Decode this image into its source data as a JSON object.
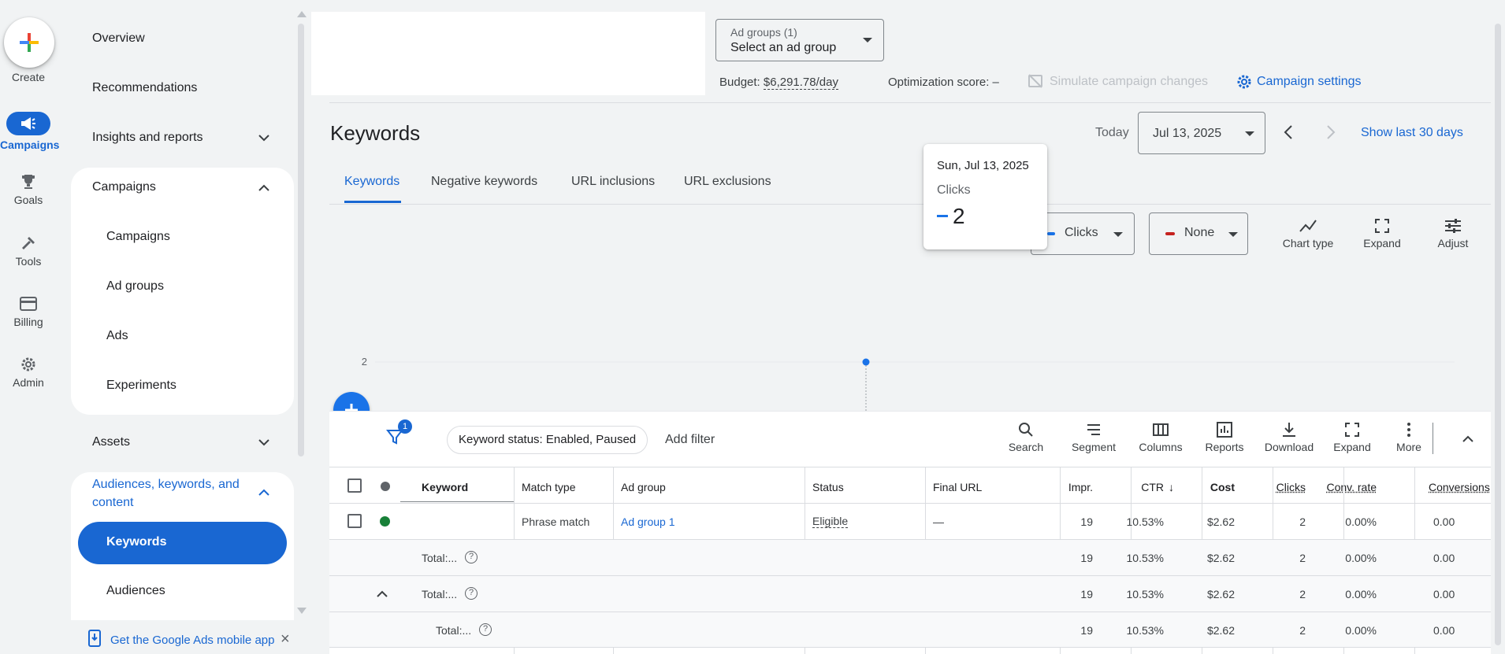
{
  "rail": {
    "create": "Create",
    "campaigns": "Campaigns",
    "goals": "Goals",
    "tools": "Tools",
    "billing": "Billing",
    "admin": "Admin"
  },
  "menu": {
    "overview": "Overview",
    "recommendations": "Recommendations",
    "insights": "Insights and reports",
    "campaigns_group": "Campaigns",
    "campaigns": "Campaigns",
    "ad_groups": "Ad groups",
    "ads": "Ads",
    "experiments": "Experiments",
    "assets": "Assets",
    "audiences_group": "Audiences, keywords, and content",
    "keywords": "Keywords",
    "audiences": "Audiences",
    "mobile_app": "Get the Google Ads mobile app"
  },
  "header": {
    "adgroup_label": "Ad groups (1)",
    "adgroup_value": "Select an ad group",
    "budget_label": "Budget:",
    "budget_value": "$6,291.78/day",
    "opt_score": "Optimization score: –",
    "simulate": "Simulate campaign changes",
    "settings": "Campaign settings"
  },
  "page": {
    "title": "Keywords",
    "today": "Today",
    "date": "Jul 13, 2025",
    "show_last": "Show last 30 days"
  },
  "tabs": [
    "Keywords",
    "Negative keywords",
    "URL inclusions",
    "URL exclusions"
  ],
  "chart_controls": {
    "metric1": "Clicks",
    "metric2": "None",
    "chart_type": "Chart type",
    "expand": "Expand",
    "adjust": "Adjust"
  },
  "tooltip": {
    "date": "Sun, Jul 13, 2025",
    "metric": "Clicks",
    "value": "2"
  },
  "chart_data": {
    "type": "line",
    "x": [
      "Jul 13, 2025"
    ],
    "series": [
      {
        "name": "Clicks",
        "values": [
          2
        ]
      }
    ],
    "yticks": [
      "0",
      "1",
      "2"
    ],
    "ylim": [
      0,
      2
    ],
    "grid": true,
    "color": "#1a73e8"
  },
  "filterbar": {
    "filter_count": "1",
    "chip": "Keyword status: Enabled, Paused",
    "add_filter": "Add filter",
    "search": "Search",
    "segment": "Segment",
    "columns": "Columns",
    "reports": "Reports",
    "download": "Download",
    "expand": "Expand",
    "more": "More"
  },
  "table": {
    "headers": [
      "Keyword",
      "Match type",
      "Ad group",
      "Status",
      "Final URL",
      "Impr.",
      "CTR",
      "Cost",
      "Clicks",
      "Conv. rate",
      "Conversions"
    ],
    "row": {
      "match": "Phrase match",
      "adgroup": "Ad group 1",
      "status": "Eligible",
      "url": "—",
      "impr": "19",
      "ctr": "10.53%",
      "cost": "$2.62",
      "clicks": "2",
      "conv_rate": "0.00%",
      "conversions": "0.00"
    },
    "totals": [
      {
        "label": "Total:...",
        "impr": "19",
        "ctr": "10.53%",
        "cost": "$2.62",
        "clicks": "2",
        "conv_rate": "0.00%",
        "conversions": "0.00"
      },
      {
        "label": "Total:...",
        "impr": "19",
        "ctr": "10.53%",
        "cost": "$2.62",
        "clicks": "2",
        "conv_rate": "0.00%",
        "conversions": "0.00"
      },
      {
        "label": "Total:...",
        "impr": "19",
        "ctr": "10.53%",
        "cost": "$2.62",
        "clicks": "2",
        "conv_rate": "0.00%",
        "conversions": "0.00"
      }
    ]
  }
}
